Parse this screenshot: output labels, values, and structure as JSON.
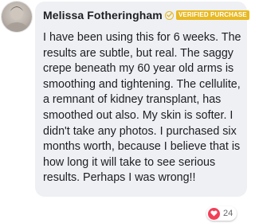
{
  "comment": {
    "author": "Melissa Fotheringham",
    "verified_label": "VERIFIED PURCHASE",
    "text": "I have been using this for 6 weeks. The results are subtle, but real. The saggy crepe beneath my 60 year old arms is smoothing and tightening. The cellulite, a remnant of kidney transplant, has smoothed out also. My skin is softer. I didn't take any photos. I purchased six months worth, because I believe that is how long it will take to see serious results. Perhaps I was wrong!!",
    "reaction_icon": "heart-icon",
    "reaction_count": "24"
  },
  "colors": {
    "bubble_bg": "#eef0f3",
    "verified_gold": "#e8b923",
    "heart_red": "#f33e58",
    "text": "#1c1e21"
  }
}
